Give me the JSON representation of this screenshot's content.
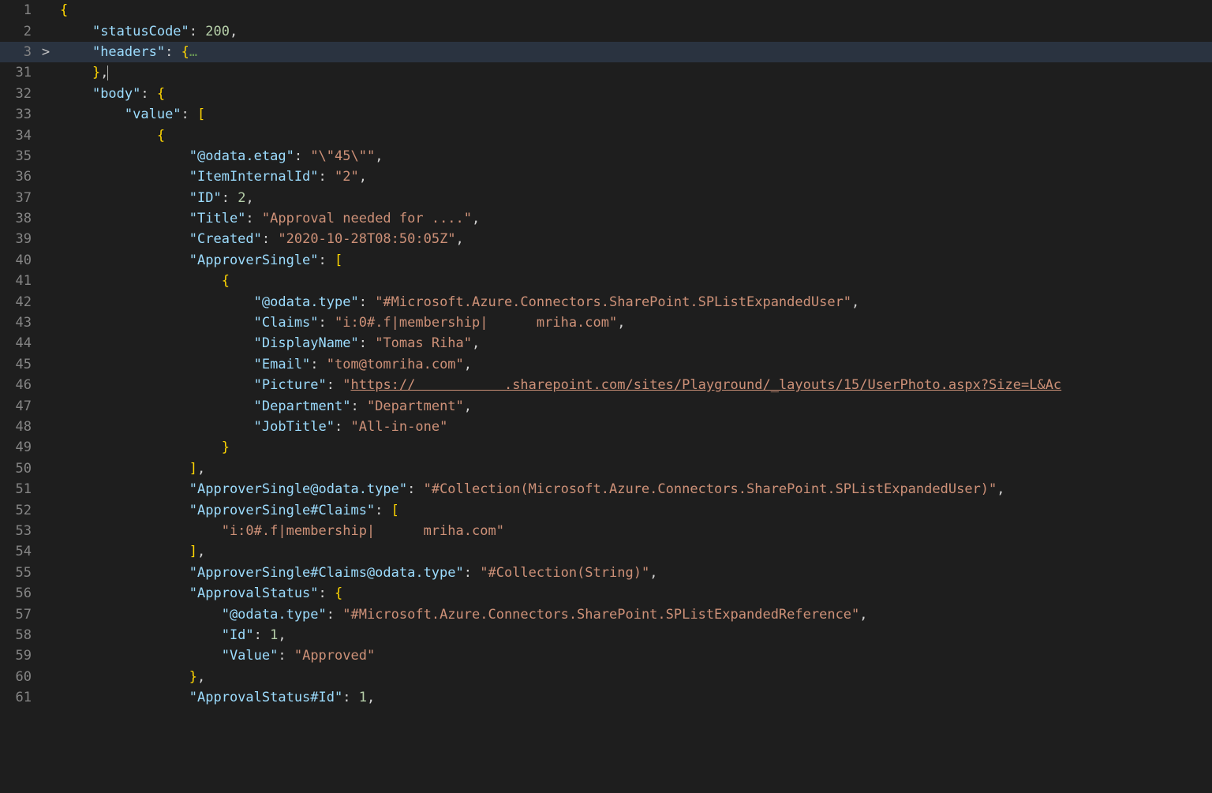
{
  "lines": [
    {
      "num": "1",
      "hl": false,
      "fold": "",
      "tokens": [
        [
          "delim",
          "{"
        ]
      ]
    },
    {
      "num": "2",
      "hl": false,
      "fold": "",
      "tokens": [
        [
          "punc",
          "    "
        ],
        [
          "key",
          "\"statusCode\""
        ],
        [
          "punc",
          ": "
        ],
        [
          "num",
          "200"
        ],
        [
          "punc",
          ","
        ]
      ]
    },
    {
      "num": "3",
      "hl": true,
      "fold": ">",
      "tokens": [
        [
          "punc",
          "    "
        ],
        [
          "key",
          "\"headers\""
        ],
        [
          "punc",
          ": "
        ],
        [
          "delim",
          "{"
        ],
        [
          "fold",
          "…"
        ]
      ]
    },
    {
      "num": "31",
      "hl": false,
      "fold": "",
      "tokens": [
        [
          "punc",
          "    "
        ],
        [
          "delim",
          "}"
        ],
        [
          "punc",
          ","
        ],
        [
          "cursor",
          ""
        ]
      ]
    },
    {
      "num": "32",
      "hl": false,
      "fold": "",
      "tokens": [
        [
          "punc",
          "    "
        ],
        [
          "key",
          "\"body\""
        ],
        [
          "punc",
          ": "
        ],
        [
          "delim",
          "{"
        ]
      ]
    },
    {
      "num": "33",
      "hl": false,
      "fold": "",
      "tokens": [
        [
          "punc",
          "        "
        ],
        [
          "key",
          "\"value\""
        ],
        [
          "punc",
          ": "
        ],
        [
          "delim",
          "["
        ]
      ]
    },
    {
      "num": "34",
      "hl": false,
      "fold": "",
      "tokens": [
        [
          "punc",
          "            "
        ],
        [
          "delim",
          "{"
        ]
      ]
    },
    {
      "num": "35",
      "hl": false,
      "fold": "",
      "tokens": [
        [
          "punc",
          "                "
        ],
        [
          "key",
          "\"@odata.etag\""
        ],
        [
          "punc",
          ": "
        ],
        [
          "string",
          "\"\\\"45\\\"\""
        ],
        [
          "punc",
          ","
        ]
      ]
    },
    {
      "num": "36",
      "hl": false,
      "fold": "",
      "tokens": [
        [
          "punc",
          "                "
        ],
        [
          "key",
          "\"ItemInternalId\""
        ],
        [
          "punc",
          ": "
        ],
        [
          "string",
          "\"2\""
        ],
        [
          "punc",
          ","
        ]
      ]
    },
    {
      "num": "37",
      "hl": false,
      "fold": "",
      "tokens": [
        [
          "punc",
          "                "
        ],
        [
          "key",
          "\"ID\""
        ],
        [
          "punc",
          ": "
        ],
        [
          "num",
          "2"
        ],
        [
          "punc",
          ","
        ]
      ]
    },
    {
      "num": "38",
      "hl": false,
      "fold": "",
      "tokens": [
        [
          "punc",
          "                "
        ],
        [
          "key",
          "\"Title\""
        ],
        [
          "punc",
          ": "
        ],
        [
          "string",
          "\"Approval needed for ....\""
        ],
        [
          "punc",
          ","
        ]
      ]
    },
    {
      "num": "39",
      "hl": false,
      "fold": "",
      "tokens": [
        [
          "punc",
          "                "
        ],
        [
          "key",
          "\"Created\""
        ],
        [
          "punc",
          ": "
        ],
        [
          "string",
          "\"2020-10-28T08:50:05Z\""
        ],
        [
          "punc",
          ","
        ]
      ]
    },
    {
      "num": "40",
      "hl": false,
      "fold": "",
      "tokens": [
        [
          "punc",
          "                "
        ],
        [
          "key",
          "\"ApproverSingle\""
        ],
        [
          "punc",
          ": "
        ],
        [
          "delim",
          "["
        ]
      ]
    },
    {
      "num": "41",
      "hl": false,
      "fold": "",
      "tokens": [
        [
          "punc",
          "                    "
        ],
        [
          "delim",
          "{"
        ]
      ]
    },
    {
      "num": "42",
      "hl": false,
      "fold": "",
      "tokens": [
        [
          "punc",
          "                        "
        ],
        [
          "key",
          "\"@odata.type\""
        ],
        [
          "punc",
          ": "
        ],
        [
          "string",
          "\"#Microsoft.Azure.Connectors.SharePoint.SPListExpandedUser\""
        ],
        [
          "punc",
          ","
        ]
      ]
    },
    {
      "num": "43",
      "hl": false,
      "fold": "",
      "tokens": [
        [
          "punc",
          "                        "
        ],
        [
          "key",
          "\"Claims\""
        ],
        [
          "punc",
          ": "
        ],
        [
          "string",
          "\"i:0#.f|membership|      mriha.com\""
        ],
        [
          "punc",
          ","
        ]
      ]
    },
    {
      "num": "44",
      "hl": false,
      "fold": "",
      "tokens": [
        [
          "punc",
          "                        "
        ],
        [
          "key",
          "\"DisplayName\""
        ],
        [
          "punc",
          ": "
        ],
        [
          "string",
          "\"Tomas Riha\""
        ],
        [
          "punc",
          ","
        ]
      ]
    },
    {
      "num": "45",
      "hl": false,
      "fold": "",
      "tokens": [
        [
          "punc",
          "                        "
        ],
        [
          "key",
          "\"Email\""
        ],
        [
          "punc",
          ": "
        ],
        [
          "string",
          "\"tom@tomriha.com\""
        ],
        [
          "punc",
          ","
        ]
      ]
    },
    {
      "num": "46",
      "hl": false,
      "fold": "",
      "tokens": [
        [
          "punc",
          "                        "
        ],
        [
          "key",
          "\"Picture\""
        ],
        [
          "punc",
          ": "
        ],
        [
          "string",
          "\""
        ],
        [
          "link",
          "https://           .sharepoint.com/sites/Playground/_layouts/15/UserPhoto.aspx?Size=L&Ac"
        ]
      ]
    },
    {
      "num": "47",
      "hl": false,
      "fold": "",
      "tokens": [
        [
          "punc",
          "                        "
        ],
        [
          "key",
          "\"Department\""
        ],
        [
          "punc",
          ": "
        ],
        [
          "string",
          "\"Department\""
        ],
        [
          "punc",
          ","
        ]
      ]
    },
    {
      "num": "48",
      "hl": false,
      "fold": "",
      "tokens": [
        [
          "punc",
          "                        "
        ],
        [
          "key",
          "\"JobTitle\""
        ],
        [
          "punc",
          ": "
        ],
        [
          "string",
          "\"All-in-one\""
        ]
      ]
    },
    {
      "num": "49",
      "hl": false,
      "fold": "",
      "tokens": [
        [
          "punc",
          "                    "
        ],
        [
          "delim",
          "}"
        ]
      ]
    },
    {
      "num": "50",
      "hl": false,
      "fold": "",
      "tokens": [
        [
          "punc",
          "                "
        ],
        [
          "delim",
          "]"
        ],
        [
          "punc",
          ","
        ]
      ]
    },
    {
      "num": "51",
      "hl": false,
      "fold": "",
      "tokens": [
        [
          "punc",
          "                "
        ],
        [
          "key",
          "\"ApproverSingle@odata.type\""
        ],
        [
          "punc",
          ": "
        ],
        [
          "string",
          "\"#Collection(Microsoft.Azure.Connectors.SharePoint.SPListExpandedUser)\""
        ],
        [
          "punc",
          ","
        ]
      ]
    },
    {
      "num": "52",
      "hl": false,
      "fold": "",
      "tokens": [
        [
          "punc",
          "                "
        ],
        [
          "key",
          "\"ApproverSingle#Claims\""
        ],
        [
          "punc",
          ": "
        ],
        [
          "delim",
          "["
        ]
      ]
    },
    {
      "num": "53",
      "hl": false,
      "fold": "",
      "tokens": [
        [
          "punc",
          "                    "
        ],
        [
          "string",
          "\"i:0#.f|membership|      mriha.com\""
        ]
      ]
    },
    {
      "num": "54",
      "hl": false,
      "fold": "",
      "tokens": [
        [
          "punc",
          "                "
        ],
        [
          "delim",
          "]"
        ],
        [
          "punc",
          ","
        ]
      ]
    },
    {
      "num": "55",
      "hl": false,
      "fold": "",
      "tokens": [
        [
          "punc",
          "                "
        ],
        [
          "key",
          "\"ApproverSingle#Claims@odata.type\""
        ],
        [
          "punc",
          ": "
        ],
        [
          "string",
          "\"#Collection(String)\""
        ],
        [
          "punc",
          ","
        ]
      ]
    },
    {
      "num": "56",
      "hl": false,
      "fold": "",
      "tokens": [
        [
          "punc",
          "                "
        ],
        [
          "key",
          "\"ApprovalStatus\""
        ],
        [
          "punc",
          ": "
        ],
        [
          "delim",
          "{"
        ]
      ]
    },
    {
      "num": "57",
      "hl": false,
      "fold": "",
      "tokens": [
        [
          "punc",
          "                    "
        ],
        [
          "key",
          "\"@odata.type\""
        ],
        [
          "punc",
          ": "
        ],
        [
          "string",
          "\"#Microsoft.Azure.Connectors.SharePoint.SPListExpandedReference\""
        ],
        [
          "punc",
          ","
        ]
      ]
    },
    {
      "num": "58",
      "hl": false,
      "fold": "",
      "tokens": [
        [
          "punc",
          "                    "
        ],
        [
          "key",
          "\"Id\""
        ],
        [
          "punc",
          ": "
        ],
        [
          "num",
          "1"
        ],
        [
          "punc",
          ","
        ]
      ]
    },
    {
      "num": "59",
      "hl": false,
      "fold": "",
      "tokens": [
        [
          "punc",
          "                    "
        ],
        [
          "key",
          "\"Value\""
        ],
        [
          "punc",
          ": "
        ],
        [
          "string",
          "\"Approved\""
        ]
      ]
    },
    {
      "num": "60",
      "hl": false,
      "fold": "",
      "tokens": [
        [
          "punc",
          "                "
        ],
        [
          "delim",
          "}"
        ],
        [
          "punc",
          ","
        ]
      ]
    },
    {
      "num": "61",
      "hl": false,
      "fold": "",
      "tokens": [
        [
          "punc",
          "                "
        ],
        [
          "key",
          "\"ApprovalStatus#Id\""
        ],
        [
          "punc",
          ": "
        ],
        [
          "num",
          "1"
        ],
        [
          "punc",
          ","
        ]
      ]
    }
  ]
}
